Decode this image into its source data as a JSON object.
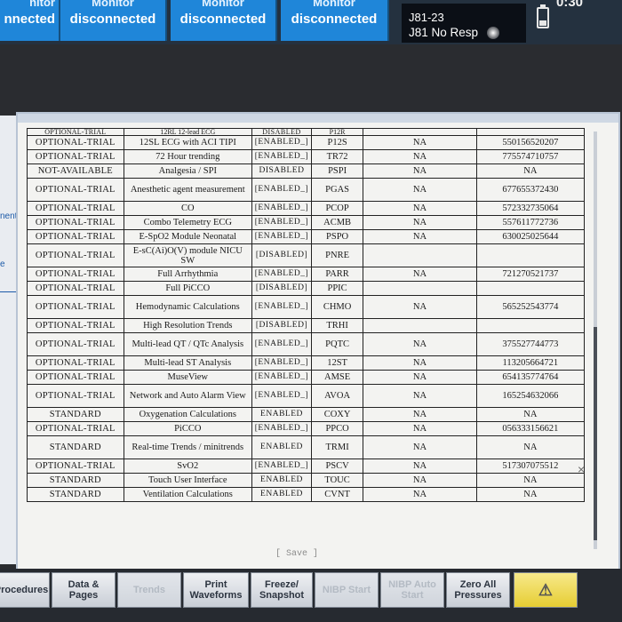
{
  "topbar": {
    "tiles": [
      {
        "line1": "nitor",
        "line2": "nnected"
      },
      {
        "line1": "Monitor",
        "line2": "disconnected"
      },
      {
        "line1": "Monitor",
        "line2": "disconnected"
      },
      {
        "line1": "Monitor",
        "line2": "disconnected"
      }
    ],
    "alarm": {
      "line1": "J81-23",
      "line2": "J81 No Resp"
    },
    "clock": "0:30",
    "battery_icon": "battery-icon"
  },
  "left_strip": {
    "text1": "nent",
    "text2": "e"
  },
  "table": {
    "partial_top": [
      "OPTIONAL-TRIAL",
      "12RL 12-lead ECG",
      "DISABLED",
      "P12R",
      "",
      ""
    ],
    "rows": [
      [
        "OPTIONAL-TRIAL",
        "12SL ECG with ACI TIPI",
        "[ENABLED_]",
        "P12S",
        "NA",
        "550156520207"
      ],
      [
        "OPTIONAL-TRIAL",
        "72 Hour trending",
        "[ENABLED_]",
        "TR72",
        "NA",
        "775574710757"
      ],
      [
        "NOT-AVAILABLE",
        "Analgesia / SPI",
        "DISABLED",
        "PSPI",
        "NA",
        "NA"
      ],
      [
        "OPTIONAL-TRIAL",
        "Anesthetic agent measurement",
        "[ENABLED_]",
        "PGAS",
        "NA",
        "677655372430"
      ],
      [
        "OPTIONAL-TRIAL",
        "CO",
        "[ENABLED_]",
        "PCOP",
        "NA",
        "572332735064"
      ],
      [
        "OPTIONAL-TRIAL",
        "Combo Telemetry ECG",
        "[ENABLED_]",
        "ACMB",
        "NA",
        "557611772736"
      ],
      [
        "OPTIONAL-TRIAL",
        "E-SpO2 Module Neonatal",
        "[ENABLED_]",
        "PSPO",
        "NA",
        "630025025644"
      ],
      [
        "OPTIONAL-TRIAL",
        "E-sC(Ai)O(V) module NICU SW",
        "[DISABLED]",
        "PNRE",
        "",
        ""
      ],
      [
        "OPTIONAL-TRIAL",
        "Full Arrhythmia",
        "[ENABLED_]",
        "PARR",
        "NA",
        "721270521737"
      ],
      [
        "OPTIONAL-TRIAL",
        "Full PiCCO",
        "[DISABLED]",
        "PPIC",
        "",
        ""
      ],
      [
        "OPTIONAL-TRIAL",
        "Hemodynamic Calculations",
        "[ENABLED_]",
        "CHMO",
        "NA",
        "565252543774"
      ],
      [
        "OPTIONAL-TRIAL",
        "High Resolution Trends",
        "[DISABLED]",
        "TRHI",
        "",
        ""
      ],
      [
        "OPTIONAL-TRIAL",
        "Multi-lead QT / QTc Analysis",
        "[ENABLED_]",
        "PQTC",
        "NA",
        "375527744773"
      ],
      [
        "OPTIONAL-TRIAL",
        "Multi-lead ST Analysis",
        "[ENABLED_]",
        "12ST",
        "NA",
        "113205664721"
      ],
      [
        "OPTIONAL-TRIAL",
        "MuseView",
        "[ENABLED_]",
        "AMSE",
        "NA",
        "654135774764"
      ],
      [
        "OPTIONAL-TRIAL",
        "Network and Auto Alarm View",
        "[ENABLED_]",
        "AVOA",
        "NA",
        "165254632066"
      ],
      [
        "STANDARD",
        "Oxygenation Calculations",
        "ENABLED",
        "COXY",
        "NA",
        "NA"
      ],
      [
        "OPTIONAL-TRIAL",
        "PiCCO",
        "[ENABLED_]",
        "PPCO",
        "NA",
        "056333156621"
      ],
      [
        "STANDARD",
        "Real-time Trends / minitrends",
        "ENABLED",
        "TRMI",
        "NA",
        "NA"
      ],
      [
        "OPTIONAL-TRIAL",
        "SvO2",
        "[ENABLED_]",
        "PSCV",
        "NA",
        "517307075512"
      ],
      [
        "STANDARD",
        "Touch User Interface",
        "ENABLED",
        "TOUC",
        "NA",
        "NA"
      ],
      [
        "STANDARD",
        "Ventilation Calculations",
        "ENABLED",
        "CVNT",
        "NA",
        "NA"
      ]
    ],
    "tall_rows": [
      3,
      7,
      10,
      12,
      15,
      18
    ]
  },
  "save_label": "[ Save ]",
  "close_icon": "×",
  "softkeys": [
    {
      "label": "Procedures",
      "dim": false
    },
    {
      "label": "Data & Pages",
      "dim": false
    },
    {
      "label": "Trends",
      "dim": true
    },
    {
      "label": "Print Waveforms",
      "dim": false
    },
    {
      "label": "Freeze/ Snapshot",
      "dim": false
    },
    {
      "label": "NIBP Start",
      "dim": true
    },
    {
      "label": "NIBP Auto Start",
      "dim": true
    },
    {
      "label": "Zero All Pressures",
      "dim": false
    }
  ],
  "alarm_softkey_icon": "alarm-bell-icon",
  "colors": {
    "tile_blue": "#1f86d9",
    "alarm_yellow": "#e6cd33"
  }
}
